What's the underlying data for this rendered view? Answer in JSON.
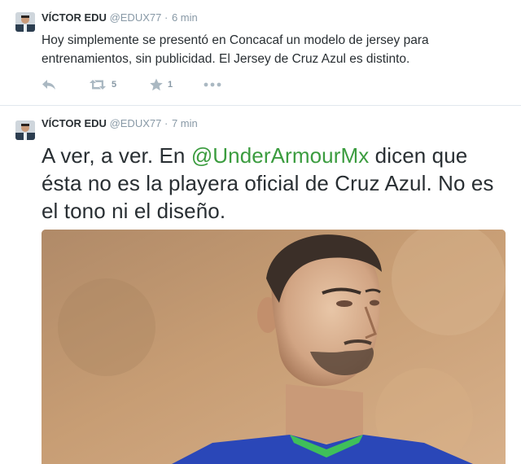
{
  "tweets": [
    {
      "author_name": "VÍCTOR EDU",
      "handle": "@EDUX77",
      "separator": "·",
      "time": "6 min",
      "text": "Hoy simplemente se presentó en Concacaf un modelo de jersey para entrenamientos, sin publicidad. El Jersey de Cruz Azul es distinto.",
      "actions": {
        "reply_icon": "reply-icon",
        "retweet_icon": "retweet-icon",
        "retweet_count": "5",
        "favorite_icon": "star-icon",
        "favorite_count": "1",
        "more_icon": "more-icon"
      }
    },
    {
      "author_name": "VÍCTOR EDU",
      "handle": "@EDUX77",
      "separator": "·",
      "time": "7 min",
      "text_before": "A ver, a ver. En ",
      "mention": "@UnderArmourMx",
      "text_after": " dicen que ésta no es la playera oficial de Cruz Azul. No es el tono ni el diseño.",
      "photo": "mannequin-photo"
    }
  ],
  "colors": {
    "mention": "#3b9c3f",
    "meta": "#8899a6",
    "icon": "#aab8c2",
    "divider": "#e1e8ed",
    "text": "#292f33"
  }
}
